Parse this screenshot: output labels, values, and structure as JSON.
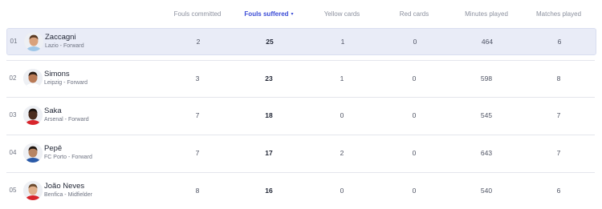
{
  "columns": [
    {
      "label": "Fouls committed",
      "active": false
    },
    {
      "label": "Fouls suffered",
      "active": true
    },
    {
      "label": "Yellow cards",
      "active": false
    },
    {
      "label": "Red cards",
      "active": false
    },
    {
      "label": "Minutes played",
      "active": false
    },
    {
      "label": "Matches played",
      "active": false
    }
  ],
  "sort_caret": "▾",
  "rows": [
    {
      "rank": "01",
      "name": "Zaccagni",
      "club_position": "Lazio - Forward",
      "fouls_committed": "2",
      "fouls_suffered": "25",
      "yellow_cards": "1",
      "red_cards": "0",
      "minutes_played": "464",
      "matches_played": "6",
      "highlighted": true,
      "skin": "#d9a27c",
      "hair": "#5a3a22",
      "shirt": "#9fc7e8"
    },
    {
      "rank": "02",
      "name": "Simons",
      "club_position": "Leipzig - Forward",
      "fouls_committed": "3",
      "fouls_suffered": "23",
      "yellow_cards": "1",
      "red_cards": "0",
      "minutes_played": "598",
      "matches_played": "8",
      "highlighted": false,
      "skin": "#b97a56",
      "hair": "#2b1c14",
      "shirt": "#ffffff"
    },
    {
      "rank": "03",
      "name": "Saka",
      "club_position": "Arsenal - Forward",
      "fouls_committed": "7",
      "fouls_suffered": "18",
      "yellow_cards": "0",
      "red_cards": "0",
      "minutes_played": "545",
      "matches_played": "7",
      "highlighted": false,
      "skin": "#4a2c1e",
      "hair": "#1a110c",
      "shirt": "#d8252c"
    },
    {
      "rank": "04",
      "name": "Pepê",
      "club_position": "FC Porto - Forward",
      "fouls_committed": "7",
      "fouls_suffered": "17",
      "yellow_cards": "2",
      "red_cards": "0",
      "minutes_played": "643",
      "matches_played": "7",
      "highlighted": false,
      "skin": "#b78563",
      "hair": "#1f1610",
      "shirt": "#2a5aa8"
    },
    {
      "rank": "05",
      "name": "João Neves",
      "club_position": "Benfica - Midfielder",
      "fouls_committed": "8",
      "fouls_suffered": "16",
      "yellow_cards": "0",
      "red_cards": "0",
      "minutes_played": "540",
      "matches_played": "6",
      "highlighted": false,
      "skin": "#e0b08c",
      "hair": "#6b4a2e",
      "shirt": "#d8252c"
    }
  ]
}
